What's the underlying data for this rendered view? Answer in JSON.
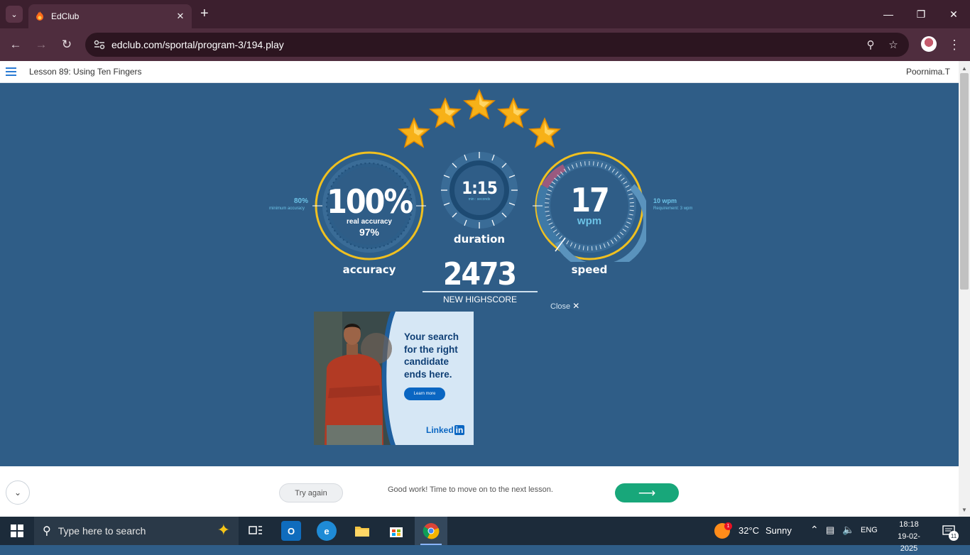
{
  "browser": {
    "tab_title": "EdClub",
    "url": "edclub.com/sportal/program-3/194.play"
  },
  "page": {
    "lesson_title": "Lesson 89: Using Ten Fingers",
    "user_name": "Poornima.T"
  },
  "results": {
    "stars_earned": 5,
    "stars_total": 5,
    "accuracy": {
      "value": "100%",
      "real_label": "real accuracy",
      "real_value": "97%",
      "label": "accuracy",
      "minimum_value": "80%",
      "minimum_label": "minimum accuracy"
    },
    "duration": {
      "value": "1:15",
      "unit": "min : seconds",
      "label": "duration"
    },
    "speed": {
      "value": "17",
      "unit": "wpm",
      "label": "speed",
      "target_value": "10 wpm",
      "requirement_label": "Requirement: 3 wpm"
    },
    "score": "2473",
    "score_label": "NEW HIGHSCORE",
    "close_label": "Close"
  },
  "ad": {
    "headline": "Your search for the right candidate ends here.",
    "cta": "Learn more",
    "brand": "Linked",
    "brand_in": "in"
  },
  "footer": {
    "try_again": "Try again",
    "message": "Good work! Time to move on to the next lesson.",
    "next_arrow": "⟶"
  },
  "taskbar": {
    "search_placeholder": "Type here to search",
    "weather_temp": "32°C",
    "weather_desc": "Sunny",
    "weather_badge": "1",
    "language": "ENG",
    "time": "18:18",
    "date": "19-02-2025",
    "notification_count": "11"
  },
  "colors": {
    "results_bg": "#2f5d87",
    "gauge_ring": "#f0c020",
    "accent_cyan": "#6cc2e6",
    "next_button": "#18a77a"
  }
}
